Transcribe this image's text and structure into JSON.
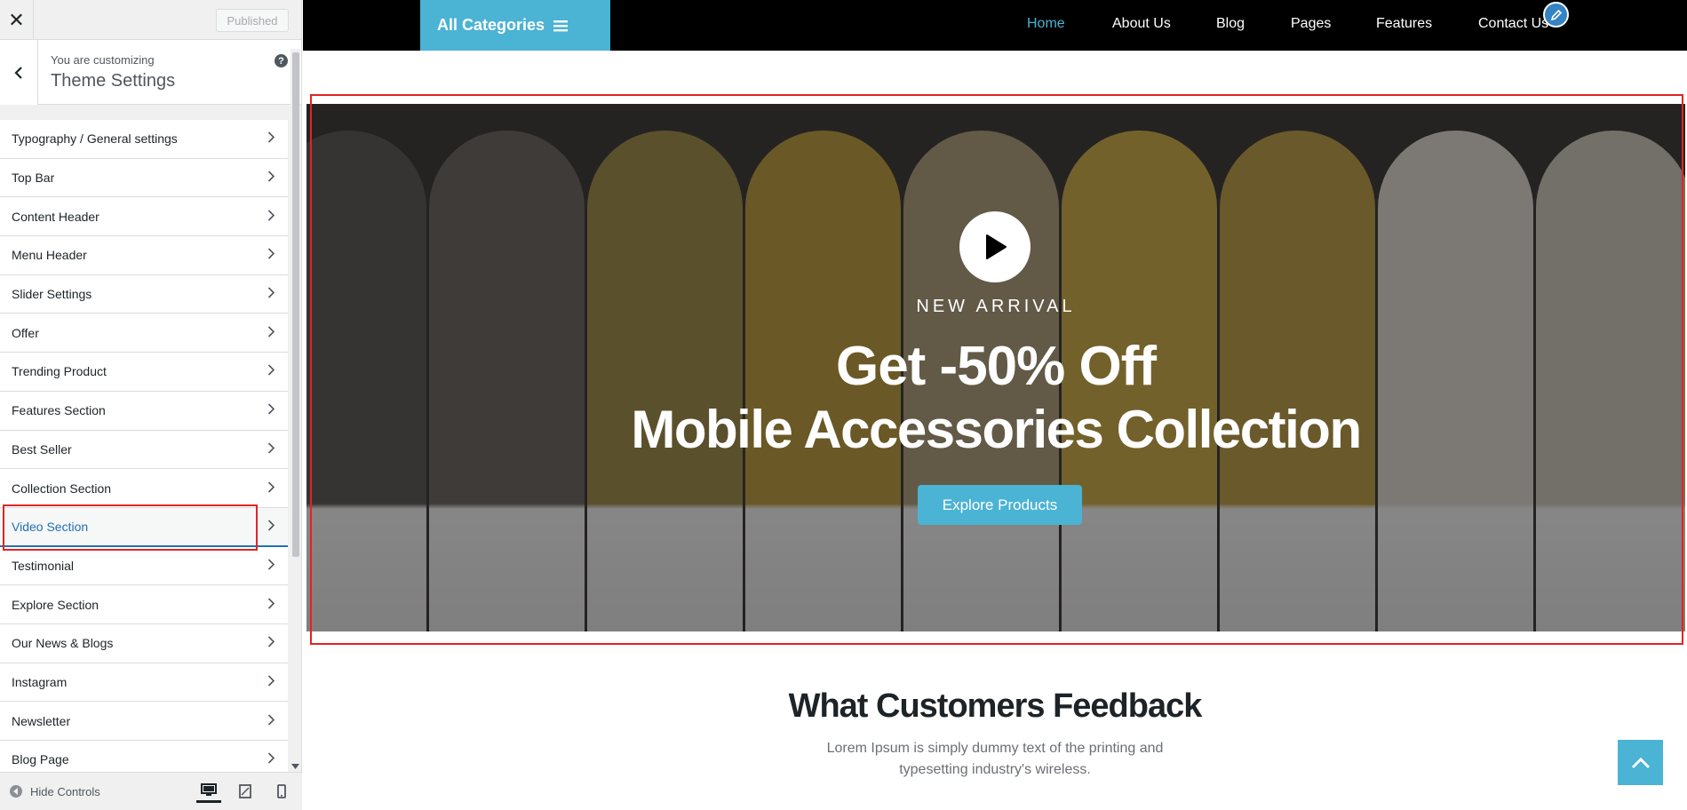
{
  "customizer": {
    "published_label": "Published",
    "customizing_label": "You are customizing",
    "panel_title": "Theme Settings",
    "help_label": "?",
    "sections": [
      {
        "label": "Typography / General settings"
      },
      {
        "label": "Top Bar"
      },
      {
        "label": "Content Header"
      },
      {
        "label": "Menu Header"
      },
      {
        "label": "Slider Settings"
      },
      {
        "label": "Offer"
      },
      {
        "label": "Trending Product"
      },
      {
        "label": "Features Section"
      },
      {
        "label": "Best Seller"
      },
      {
        "label": "Collection Section"
      },
      {
        "label": "Video Section"
      },
      {
        "label": "Testimonial"
      },
      {
        "label": "Explore Section"
      },
      {
        "label": "Our News & Blogs"
      },
      {
        "label": "Instagram"
      },
      {
        "label": "Newsletter"
      },
      {
        "label": "Blog Page"
      }
    ],
    "active_section": "Video Section",
    "hide_controls_label": "Hide Controls",
    "preview_devices": [
      "desktop-icon",
      "tablet-icon",
      "mobile-icon"
    ]
  },
  "site": {
    "all_categories_label": "All Categories",
    "nav": [
      {
        "label": "Home",
        "active": true
      },
      {
        "label": "About Us"
      },
      {
        "label": "Blog"
      },
      {
        "label": "Pages"
      },
      {
        "label": "Features"
      },
      {
        "label": "Contact Us"
      }
    ],
    "hero": {
      "eyebrow": "NEW ARRIVAL",
      "headline_1": "Get -50% Off",
      "headline_2": "Mobile Accessories Collection",
      "cta": "Explore Products"
    },
    "feedback": {
      "title": "What Customers Feedback",
      "text": "Lorem Ipsum is simply dummy text of the printing and typesetting industry's wireless."
    }
  },
  "colors": {
    "accent": "#4bb3d4",
    "highlight": "#e02424",
    "wp_blue": "#2271b1"
  }
}
